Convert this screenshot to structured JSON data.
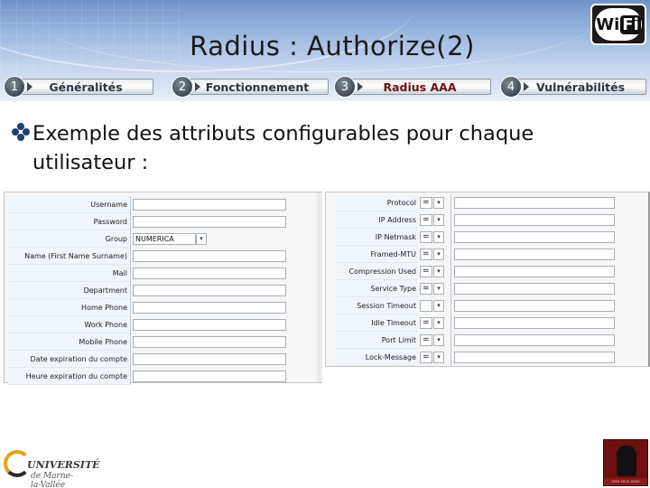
{
  "slide": {
    "title": "Radius : Authorize(2)",
    "bullet": "Exemple  des attributs configurables pour chaque utilisateur :"
  },
  "nav": [
    {
      "num": "1",
      "label": "Généralités",
      "active": false
    },
    {
      "num": "2",
      "label": "Fonctionnement",
      "active": false
    },
    {
      "num": "3",
      "label": "Radius AAA",
      "active": true
    },
    {
      "num": "4",
      "label": "Vulnérabilités",
      "active": false
    }
  ],
  "left_form": {
    "rows": [
      {
        "label": "Username",
        "value": ""
      },
      {
        "label": "Password",
        "value": ""
      },
      {
        "label": "Group",
        "value": "NUMERICA"
      },
      {
        "label": "Name (First Name Surname)",
        "value": ""
      },
      {
        "label": "Mail",
        "value": ""
      },
      {
        "label": "Department",
        "value": ""
      },
      {
        "label": "Home Phone",
        "value": ""
      },
      {
        "label": "Work Phone",
        "value": ""
      },
      {
        "label": "Mobile Phone",
        "value": ""
      },
      {
        "label": "Date expiration du compte",
        "value": ""
      },
      {
        "label": "Heure expiration du compte",
        "value": ""
      }
    ]
  },
  "right_form": {
    "rows": [
      {
        "label": "Protocol",
        "op": "="
      },
      {
        "label": "IP Address",
        "op": "="
      },
      {
        "label": "IP Netmask",
        "op": "="
      },
      {
        "label": "Framed-MTU",
        "op": "="
      },
      {
        "label": "Compression Used",
        "op": "="
      },
      {
        "label": "Service Type",
        "op": "="
      },
      {
        "label": "Session Timeout",
        "op": ""
      },
      {
        "label": "Idle Timeout",
        "op": "="
      },
      {
        "label": "Port Limit",
        "op": "="
      },
      {
        "label": "Lock-Message",
        "op": "="
      }
    ]
  },
  "logos": {
    "wifi_w": "W",
    "wifi_i": "i",
    "wifi_fi": "Fi",
    "univ_line1": "UNIVERSITÉ",
    "univ_line2": "de Marne-la-Vallée",
    "corner_caption": "ISSN 0000-0000"
  },
  "colors": {
    "accent": "#6b1111",
    "banner": "#9eb9e0"
  }
}
